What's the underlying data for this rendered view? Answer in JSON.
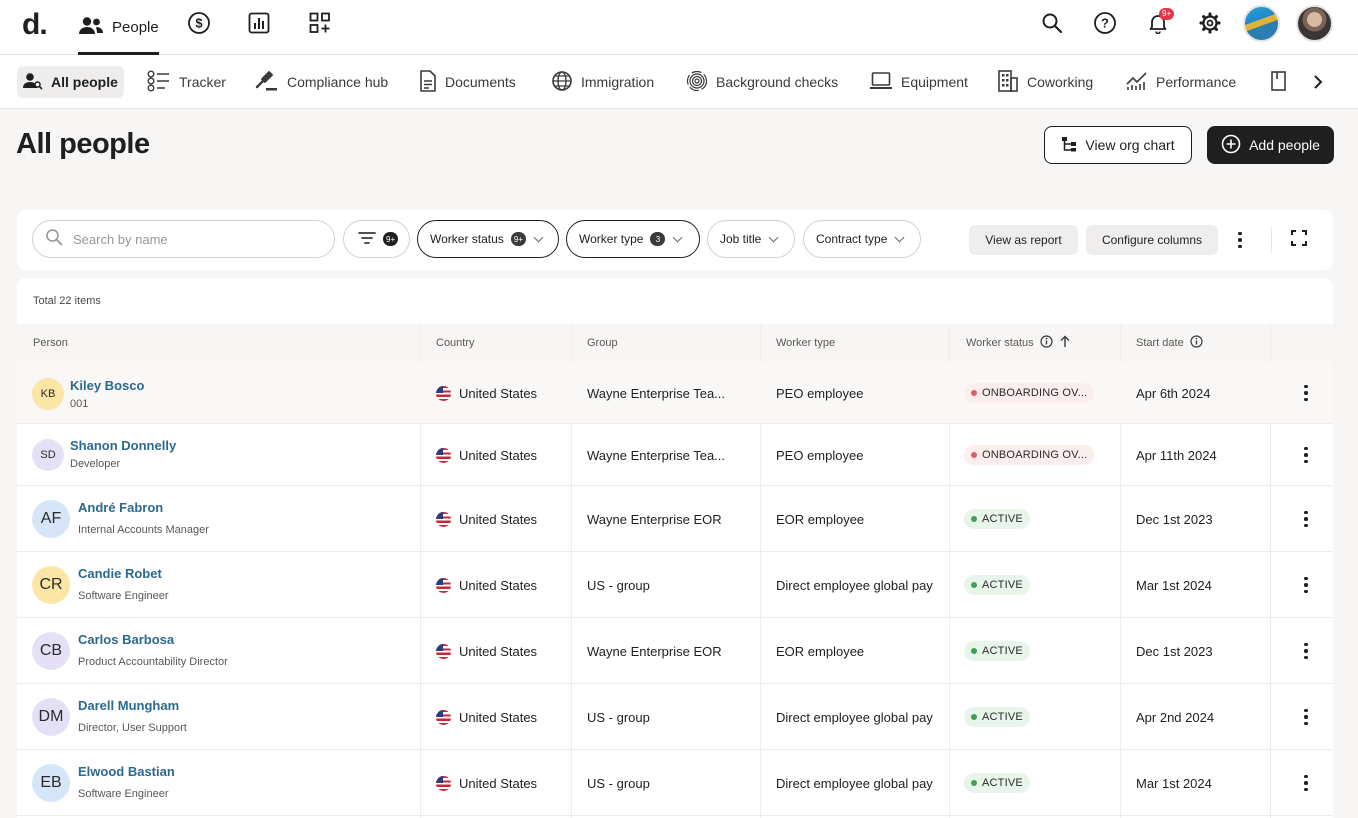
{
  "app": {
    "logo": "d.",
    "nav": [
      {
        "label": "People",
        "icon": "people-icon",
        "active": true
      },
      {
        "label": "",
        "icon": "dollar-icon"
      },
      {
        "label": "",
        "icon": "reports-icon"
      },
      {
        "label": "",
        "icon": "apps-icon"
      }
    ],
    "notifications_badge": "9+"
  },
  "subnav": [
    {
      "label": "All people",
      "icon": "person-search-icon",
      "active": true
    },
    {
      "label": "Tracker",
      "icon": "tracker-icon"
    },
    {
      "label": "Compliance hub",
      "icon": "gavel-icon"
    },
    {
      "label": "Documents",
      "icon": "document-icon"
    },
    {
      "label": "Immigration",
      "icon": "globe-icon"
    },
    {
      "label": "Background checks",
      "icon": "fingerprint-icon"
    },
    {
      "label": "Equipment",
      "icon": "laptop-icon"
    },
    {
      "label": "Coworking",
      "icon": "building-icon"
    },
    {
      "label": "Performance",
      "icon": "performance-icon"
    }
  ],
  "header": {
    "title": "All people",
    "org_chart_label": "View org chart",
    "add_people_label": "Add people"
  },
  "filters": {
    "search_placeholder": "Search by name",
    "filter_count": "9+",
    "chips": [
      {
        "label": "Worker status",
        "count": "9+",
        "selected": true
      },
      {
        "label": "Worker type",
        "count": "3",
        "selected": true
      },
      {
        "label": "Job title",
        "count": null,
        "selected": false
      },
      {
        "label": "Contract type",
        "count": null,
        "selected": false
      }
    ],
    "view_as_report": "View as report",
    "configure_columns": "Configure columns"
  },
  "table": {
    "total": "Total 22 items",
    "columns": [
      "Person",
      "Country",
      "Group",
      "Worker type",
      "Worker status",
      "Start date"
    ],
    "rows": [
      {
        "initials": "KB",
        "name": "Kiley Bosco",
        "sub": "001",
        "country": "United States",
        "group": "Wayne Enterprise Tea...",
        "worker_type": "PEO employee",
        "status": "ONBOARDING OV...",
        "status_kind": "onboarding",
        "start": "Apr 6th 2024",
        "avatar_color": "#fbe6a6"
      },
      {
        "initials": "SD",
        "name": "Shanon Donnelly",
        "sub": "Developer",
        "country": "United States",
        "group": "Wayne Enterprise Tea...",
        "worker_type": "PEO employee",
        "status": "ONBOARDING OV...",
        "status_kind": "onboarding",
        "start": "Apr 11th 2024",
        "avatar_color": "#e6e0f6"
      },
      {
        "initials": "AF",
        "name": "André Fabron",
        "sub": "Internal Accounts Manager",
        "country": "United States",
        "group": "Wayne Enterprise EOR",
        "worker_type": "EOR employee",
        "status": "ACTIVE",
        "status_kind": "active",
        "start": "Dec 1st 2023",
        "avatar_color": "#d6e6f8"
      },
      {
        "initials": "CR",
        "name": "Candie Robet",
        "sub": "Software Engineer",
        "country": "United States",
        "group": "US - group",
        "worker_type": "Direct employee global pay",
        "status": "ACTIVE",
        "status_kind": "active",
        "start": "Mar 1st 2024",
        "avatar_color": "#fbe6a6"
      },
      {
        "initials": "CB",
        "name": "Carlos Barbosa",
        "sub": "Product Accountability Director",
        "country": "United States",
        "group": "Wayne Enterprise EOR",
        "worker_type": "EOR employee",
        "status": "ACTIVE",
        "status_kind": "active",
        "start": "Dec 1st 2023",
        "avatar_color": "#e6e0f6"
      },
      {
        "initials": "DM",
        "name": "Darell Mungham",
        "sub": "Director, User Support",
        "country": "United States",
        "group": "US - group",
        "worker_type": "Direct employee global pay",
        "status": "ACTIVE",
        "status_kind": "active",
        "start": "Apr 2nd 2024",
        "avatar_color": "#e6e0f6"
      },
      {
        "initials": "EB",
        "name": "Elwood Bastian",
        "sub": "Software Engineer",
        "country": "United States",
        "group": "US - group",
        "worker_type": "Direct employee global pay",
        "status": "ACTIVE",
        "status_kind": "active",
        "start": "Mar 1st 2024",
        "avatar_color": "#d6e6f8"
      }
    ]
  }
}
